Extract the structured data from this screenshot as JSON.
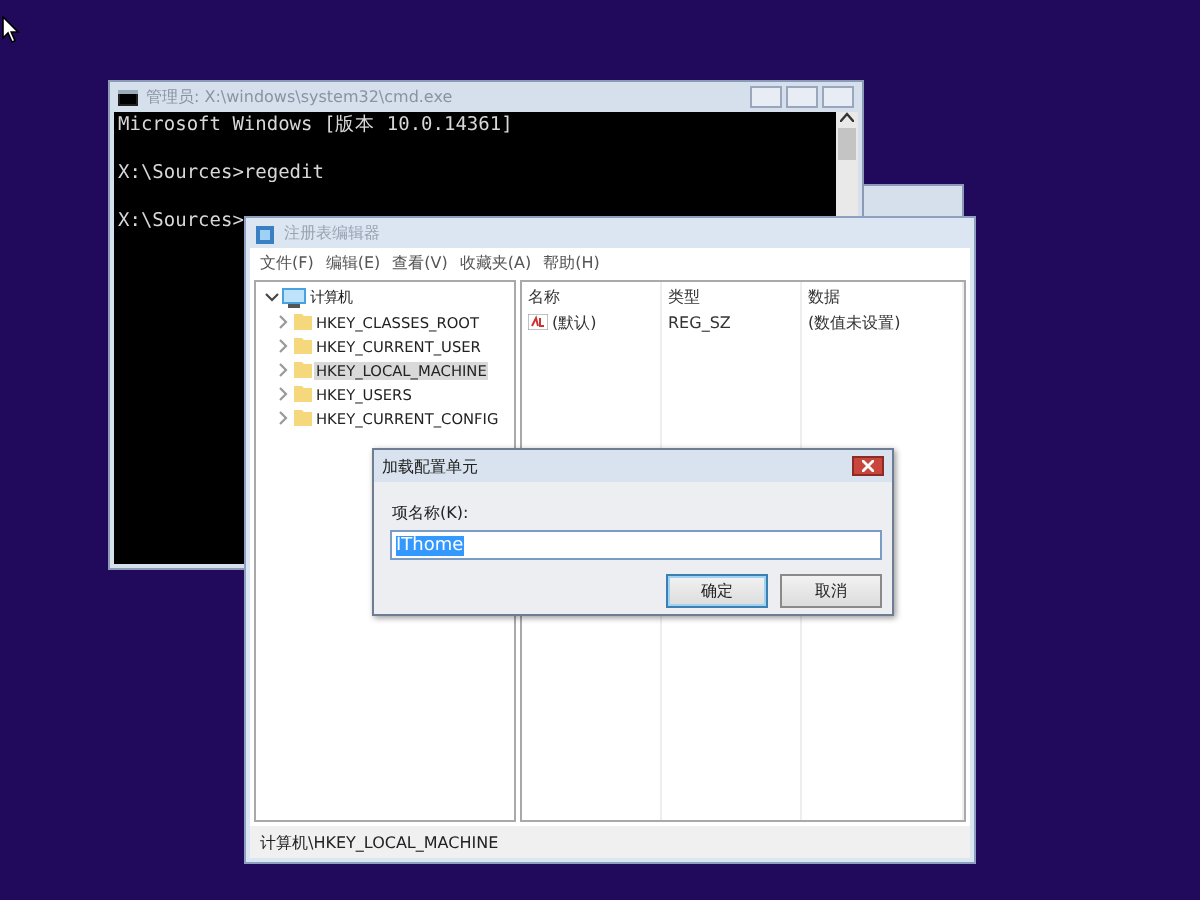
{
  "cmd_window": {
    "title": "管理员: X:\\windows\\system32\\cmd.exe",
    "lines": [
      {
        "text": "Microsoft Windows [版本 10.0.14361]",
        "gap_before": false
      },
      {
        "text": "X:\\Sources>regedit",
        "gap_before": true
      },
      {
        "text": "X:\\Sources>",
        "gap_before": true
      }
    ]
  },
  "regedit_window": {
    "title": "注册表编辑器",
    "menu": [
      "文件(F)",
      "编辑(E)",
      "查看(V)",
      "收藏夹(A)",
      "帮助(H)"
    ],
    "tree": [
      {
        "label": "计算机",
        "expanded": true,
        "selected": false,
        "children": [
          {
            "label": "HKEY_CLASSES_ROOT",
            "expanded": false,
            "selected": false
          },
          {
            "label": "HKEY_CURRENT_USER",
            "expanded": false,
            "selected": false
          },
          {
            "label": "HKEY_LOCAL_MACHINE",
            "expanded": false,
            "selected": true
          },
          {
            "label": "HKEY_USERS",
            "expanded": false,
            "selected": false
          },
          {
            "label": "HKEY_CURRENT_CONFIG",
            "expanded": false,
            "selected": false
          }
        ]
      }
    ],
    "columns": [
      "名称",
      "类型",
      "数据"
    ],
    "rows": [
      [
        "(默认)",
        "REG_SZ",
        "(数值未设置)"
      ]
    ],
    "status_bar": "计算机\\HKEY_LOCAL_MACHINE"
  },
  "dialog": {
    "title": "加载配置单元",
    "field_label": "项名称(K):",
    "field": {
      "value": "IThome",
      "value_selected": true
    },
    "buttons": [
      {
        "label": "确定",
        "default": true
      },
      {
        "label": "取消",
        "default": false
      }
    ]
  }
}
